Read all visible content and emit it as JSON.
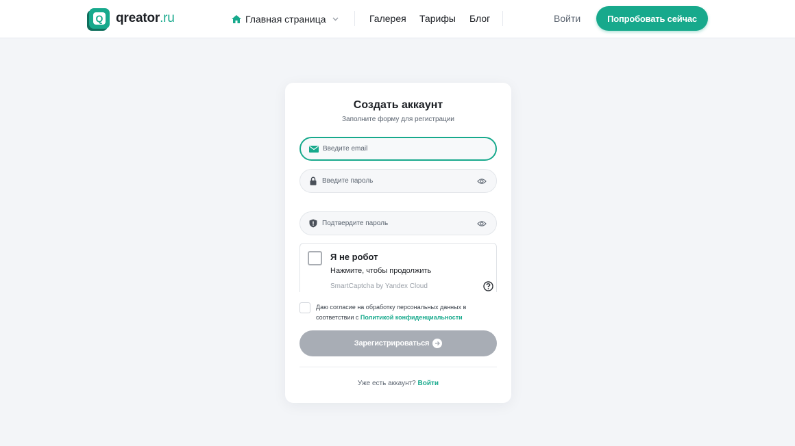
{
  "header": {
    "logo_name": "qreator",
    "logo_tld": ".ru",
    "logo_letter": "Q",
    "nav_home": "Главная страница",
    "nav_gallery": "Галерея",
    "nav_pricing": "Тарифы",
    "nav_blog": "Блог",
    "login": "Войти",
    "cta": "Попробовать сейчас"
  },
  "form": {
    "title": "Создать аккаунт",
    "subtitle": "Заполните форму для регистрации",
    "email_placeholder": "Введите email",
    "email_value": "",
    "password_placeholder": "Введите пароль",
    "password_value": "",
    "confirm_placeholder": "Подтвердите пароль",
    "confirm_value": "",
    "captcha": {
      "title": "Я не робот",
      "subtitle": "Нажмите, чтобы продолжить",
      "brand": "SmartCaptcha by Yandex Cloud",
      "checked": false
    },
    "consent": {
      "text": "Даю согласие на обработку персональных данных в соответствии с ",
      "link": "Политикой конфиденциальности",
      "checked": false
    },
    "submit_label": "Зарегистрироваться",
    "have_account": "Уже есть аккаунт?",
    "login_link": "Войти"
  },
  "icons": {
    "home": "home-icon",
    "email": "envelope-icon",
    "lock": "lock-icon",
    "shield": "shield-icon",
    "eye": "eye-icon",
    "help": "question-circle-icon",
    "arrow": "arrow-right-icon"
  },
  "colors": {
    "accent": "#17a98c",
    "accent_dark": "#0f6e5c",
    "disabled_button": "#a8adb5",
    "background": "#f3f5f8"
  }
}
